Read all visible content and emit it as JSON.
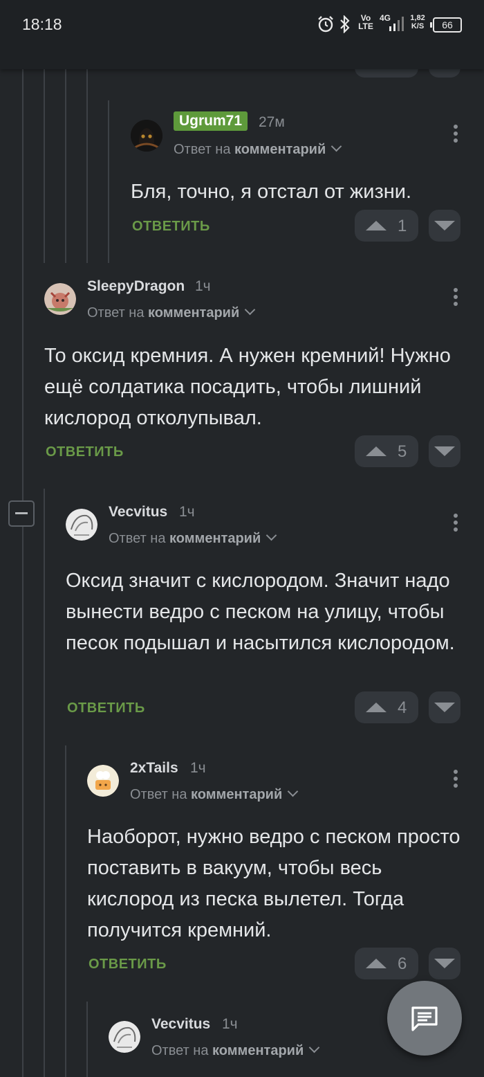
{
  "status_bar": {
    "time": "18:18",
    "network_volte": "Vo LTE",
    "network_type": "4G",
    "speed": "1,82 K/S",
    "battery": "66"
  },
  "colors": {
    "background": "#232629",
    "accent_green": "#6a9a48",
    "badge_green": "#5e9a3b"
  },
  "comments": [
    {
      "author": "Ugrum71",
      "age": "27м",
      "reply_prefix": "Ответ на",
      "reply_target": "комментарий",
      "text": "Бля, точно, я отстал от жизни.",
      "reply_label": "ОТВЕТИТЬ",
      "rating": "1"
    },
    {
      "author": "SleepyDragon",
      "age": "1ч",
      "reply_prefix": "Ответ на",
      "reply_target": "комментарий",
      "text": "То оксид кремния. А нужен кремний! Нужно ещё солдатика посадить, чтобы лишний кислород отколупывал.",
      "reply_label": "ОТВЕТИТЬ",
      "rating": "5"
    },
    {
      "author": "Vecvitus",
      "age": "1ч",
      "reply_prefix": "Ответ на",
      "reply_target": "комментарий",
      "text": "Оксид значит с кислородом. Значит надо вынести ведро с песком на улицу, чтобы песок подышал и насытился кислородом.",
      "reply_label": "ОТВЕТИТЬ",
      "rating": "4"
    },
    {
      "author": "2xTails",
      "age": "1ч",
      "reply_prefix": "Ответ на",
      "reply_target": "комментарий",
      "text": "Наоборот, нужно ведро с песком просто поставить в вакуум, чтобы весь кислород из песка вылетел. Тогда получится кремний.",
      "reply_label": "ОТВЕТИТЬ",
      "rating": "6"
    },
    {
      "author": "Vecvitus",
      "age": "1ч",
      "reply_prefix": "Ответ на",
      "reply_target": "комментарий"
    }
  ],
  "icons": {
    "fab": "chat-icon",
    "collapse": "minus-icon"
  }
}
